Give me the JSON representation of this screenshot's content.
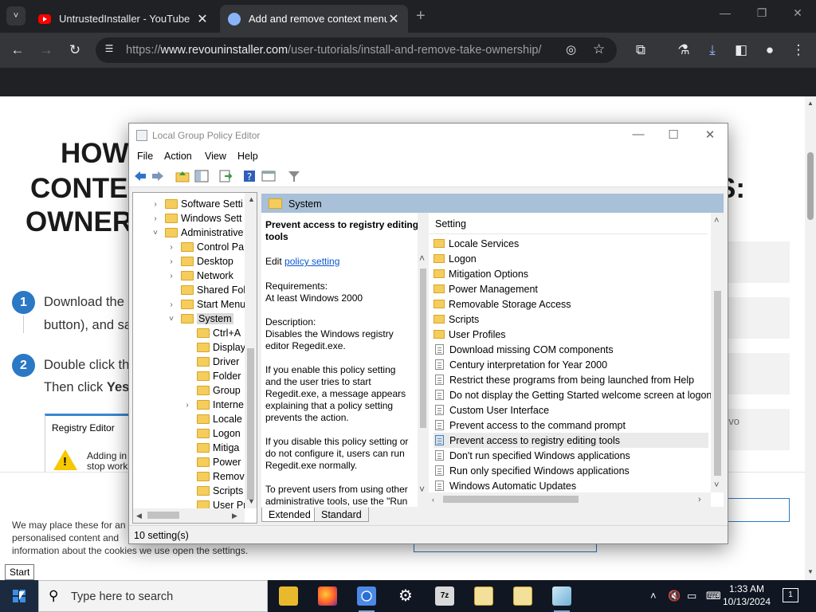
{
  "browser": {
    "tabs": [
      {
        "title": "UntrustedInstaller - YouTube",
        "icon": "youtube-icon"
      },
      {
        "title": "Add and remove context menu",
        "icon": "revo-icon"
      }
    ],
    "url": {
      "scheme": "https://",
      "host": "www.revouninstaller.com",
      "path": "/user-tutorials/install-and-remove-take-ownership/"
    }
  },
  "webpage": {
    "heading_lines": [
      "HOW",
      "CONTE",
      "OWNER",
      "S:"
    ],
    "steps": [
      {
        "num": "1",
        "line1": "Download the",
        "line2": "button), and sa"
      },
      {
        "num": "2",
        "line1": "Double click th",
        "line2_prefix": "Then click ",
        "line2_bold": "Yes"
      }
    ],
    "card": {
      "title": "Registry Editor",
      "line1": "Adding in",
      "line2": "stop work"
    },
    "side_text": "evo",
    "cookie_lines": [
      "We may place these for an",
      "personalised content and",
      "information about the cookies we use open the settings."
    ],
    "tooltip": "Start"
  },
  "gpe": {
    "title": "Local Group Policy Editor",
    "menu": [
      "File",
      "Action",
      "View",
      "Help"
    ],
    "tree": [
      {
        "label": "Software Setti",
        "level": 0,
        "exp": "›"
      },
      {
        "label": "Windows Sett",
        "level": 0,
        "exp": "›"
      },
      {
        "label": "Administrative",
        "level": 0,
        "exp": "˅"
      },
      {
        "label": "Control Pa",
        "level": 1,
        "exp": "›"
      },
      {
        "label": "Desktop",
        "level": 1,
        "exp": "›"
      },
      {
        "label": "Network",
        "level": 1,
        "exp": "›"
      },
      {
        "label": "Shared Fol",
        "level": 1,
        "exp": ""
      },
      {
        "label": "Start Menu",
        "level": 1,
        "exp": "›"
      },
      {
        "label": "System",
        "level": 1,
        "exp": "˅",
        "selected": true
      },
      {
        "label": "Ctrl+A",
        "level": 2,
        "exp": ""
      },
      {
        "label": "Display",
        "level": 2,
        "exp": ""
      },
      {
        "label": "Driver",
        "level": 2,
        "exp": ""
      },
      {
        "label": "Folder",
        "level": 2,
        "exp": ""
      },
      {
        "label": "Group",
        "level": 2,
        "exp": ""
      },
      {
        "label": "Interne",
        "level": 2,
        "exp": "›"
      },
      {
        "label": "Locale",
        "level": 2,
        "exp": ""
      },
      {
        "label": "Logon",
        "level": 2,
        "exp": ""
      },
      {
        "label": "Mitiga",
        "level": 2,
        "exp": ""
      },
      {
        "label": "Power",
        "level": 2,
        "exp": ""
      },
      {
        "label": "Remov",
        "level": 2,
        "exp": ""
      },
      {
        "label": "Scripts",
        "level": 2,
        "exp": ""
      },
      {
        "label": "User Pr",
        "level": 2,
        "exp": ""
      }
    ],
    "pane_header": "System",
    "description": {
      "title_line1": "Prevent access to registry editing",
      "title_line2": "tools",
      "edit_prefix": "Edit ",
      "edit_link": "policy setting",
      "req_label": "Requirements:",
      "req_value": "At least Windows 2000",
      "desc_label": "Description:",
      "desc_lines": [
        "Disables the Windows registry",
        "editor Regedit.exe."
      ],
      "enable_lines": [
        "If you enable this policy setting",
        "and the user tries to start",
        "Regedit.exe, a message appears",
        "explaining that a policy setting",
        "prevents the action."
      ],
      "disable_lines": [
        "If you disable this policy setting or",
        "do not configure it, users can run",
        "Regedit.exe normally."
      ],
      "prevent_lines": [
        "To prevent users from using other",
        "administrative tools, use the \"Run"
      ]
    },
    "settings_header": "Setting",
    "settings": [
      {
        "label": "Locale Services",
        "type": "folder"
      },
      {
        "label": "Logon",
        "type": "folder"
      },
      {
        "label": "Mitigation Options",
        "type": "folder"
      },
      {
        "label": "Power Management",
        "type": "folder"
      },
      {
        "label": "Removable Storage Access",
        "type": "folder"
      },
      {
        "label": "Scripts",
        "type": "folder"
      },
      {
        "label": "User Profiles",
        "type": "folder"
      },
      {
        "label": "Download missing COM components",
        "type": "policy"
      },
      {
        "label": "Century interpretation for Year 2000",
        "type": "policy"
      },
      {
        "label": "Restrict these programs from being launched from Help",
        "type": "policy"
      },
      {
        "label": "Do not display the Getting Started welcome screen at logon",
        "type": "policy"
      },
      {
        "label": "Custom User Interface",
        "type": "policy"
      },
      {
        "label": "Prevent access to the command prompt",
        "type": "policy"
      },
      {
        "label": "Prevent access to registry editing tools",
        "type": "policy",
        "selected": true
      },
      {
        "label": "Don't run specified Windows applications",
        "type": "policy"
      },
      {
        "label": "Run only specified Windows applications",
        "type": "policy"
      },
      {
        "label": "Windows Automatic Updates",
        "type": "policy"
      }
    ],
    "tabs": [
      "Extended",
      "Standard"
    ],
    "status": "10 setting(s)"
  },
  "taskbar": {
    "search_placeholder": "Type here to search",
    "time": "1:33 AM",
    "date": "10/13/2024",
    "notification_count": "1"
  }
}
